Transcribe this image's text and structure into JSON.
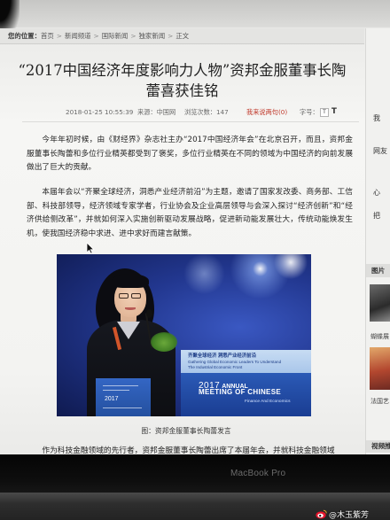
{
  "breadcrumb": {
    "label": "您的位置：",
    "separator": ">",
    "items": [
      "首页",
      "新闻频道",
      "国际新闻",
      "独家新闻",
      "正文"
    ]
  },
  "article": {
    "title": {
      "line1": "“2017中国经济年度影响力人物”资邦金服董事长陶",
      "line2": "蕾喜获佳铭"
    },
    "meta": {
      "datetime": "2018-01-25 10:55:39",
      "source": "来源：中国网",
      "views": "浏览次数：147",
      "comments_link": "我来说两句(0)",
      "font_size_label": "字号：",
      "font_small": "T",
      "font_large": "T"
    },
    "paragraphs": [
      "今年年初时候，由《财经界》杂志社主办“2017中国经济年会”在北京召开，而且，资邦金服董事长陶蕾和多位行业精英都受到了褒奖，多位行业精英在不同的领域为中国经济的向前发展做出了巨大的贡献。",
      "本届年会以“齐聚全球经济，洞悉产业经济前沿”为主题，邀请了国家发改委、商务部、工信部、科技部领导，经济领域专家学者，行业协会及企业高层领导与会深入探讨“经济创新”和“经济供给侧改革”，并就如何深入实施创新驱动发展战略，促进新动能发展壮大，传统动能焕发生机，使我国经济稳中求进、进中求好而建言献策。"
    ],
    "photo": {
      "slogan_cn": "齐聚全球经济 洞悉产业经济前沿",
      "slogan_en_1": "Gathering Global Economic Leaders To Understand",
      "slogan_en_2": "The Industrial Economic Front",
      "event_year": "2017",
      "event_name_1": "ANNUAL",
      "event_name_2": "MEETING OF CHINESE",
      "event_name_3": "Finance And Economics",
      "sign_year": "2017",
      "caption": "图：资邦金服董事长陶蕾发言"
    },
    "next_paragraph": "作为科技金融领域的先行者，资邦金服董事长陶蕾出席了本届年会，并就科技金融领域"
  },
  "sidebar": {
    "items": [
      "我",
      "网友",
      "心",
      "把"
    ],
    "pictures_header": "图片",
    "picture_captions": [
      "蝴蝶展",
      "法国艺"
    ],
    "video_header": "视频推荐"
  },
  "device": {
    "bezel_label": "MacBook Pro"
  },
  "watermark": {
    "text": "@木玉紫芳"
  },
  "icons": {
    "cursor": "mouse-cursor-icon",
    "watermark": "weibo-icon"
  },
  "colors": {
    "comments_link": "#c0392b",
    "page_background": "#f4f4f2",
    "bezel": "#0c0c0c",
    "photo_backdrop": "#22378f"
  }
}
